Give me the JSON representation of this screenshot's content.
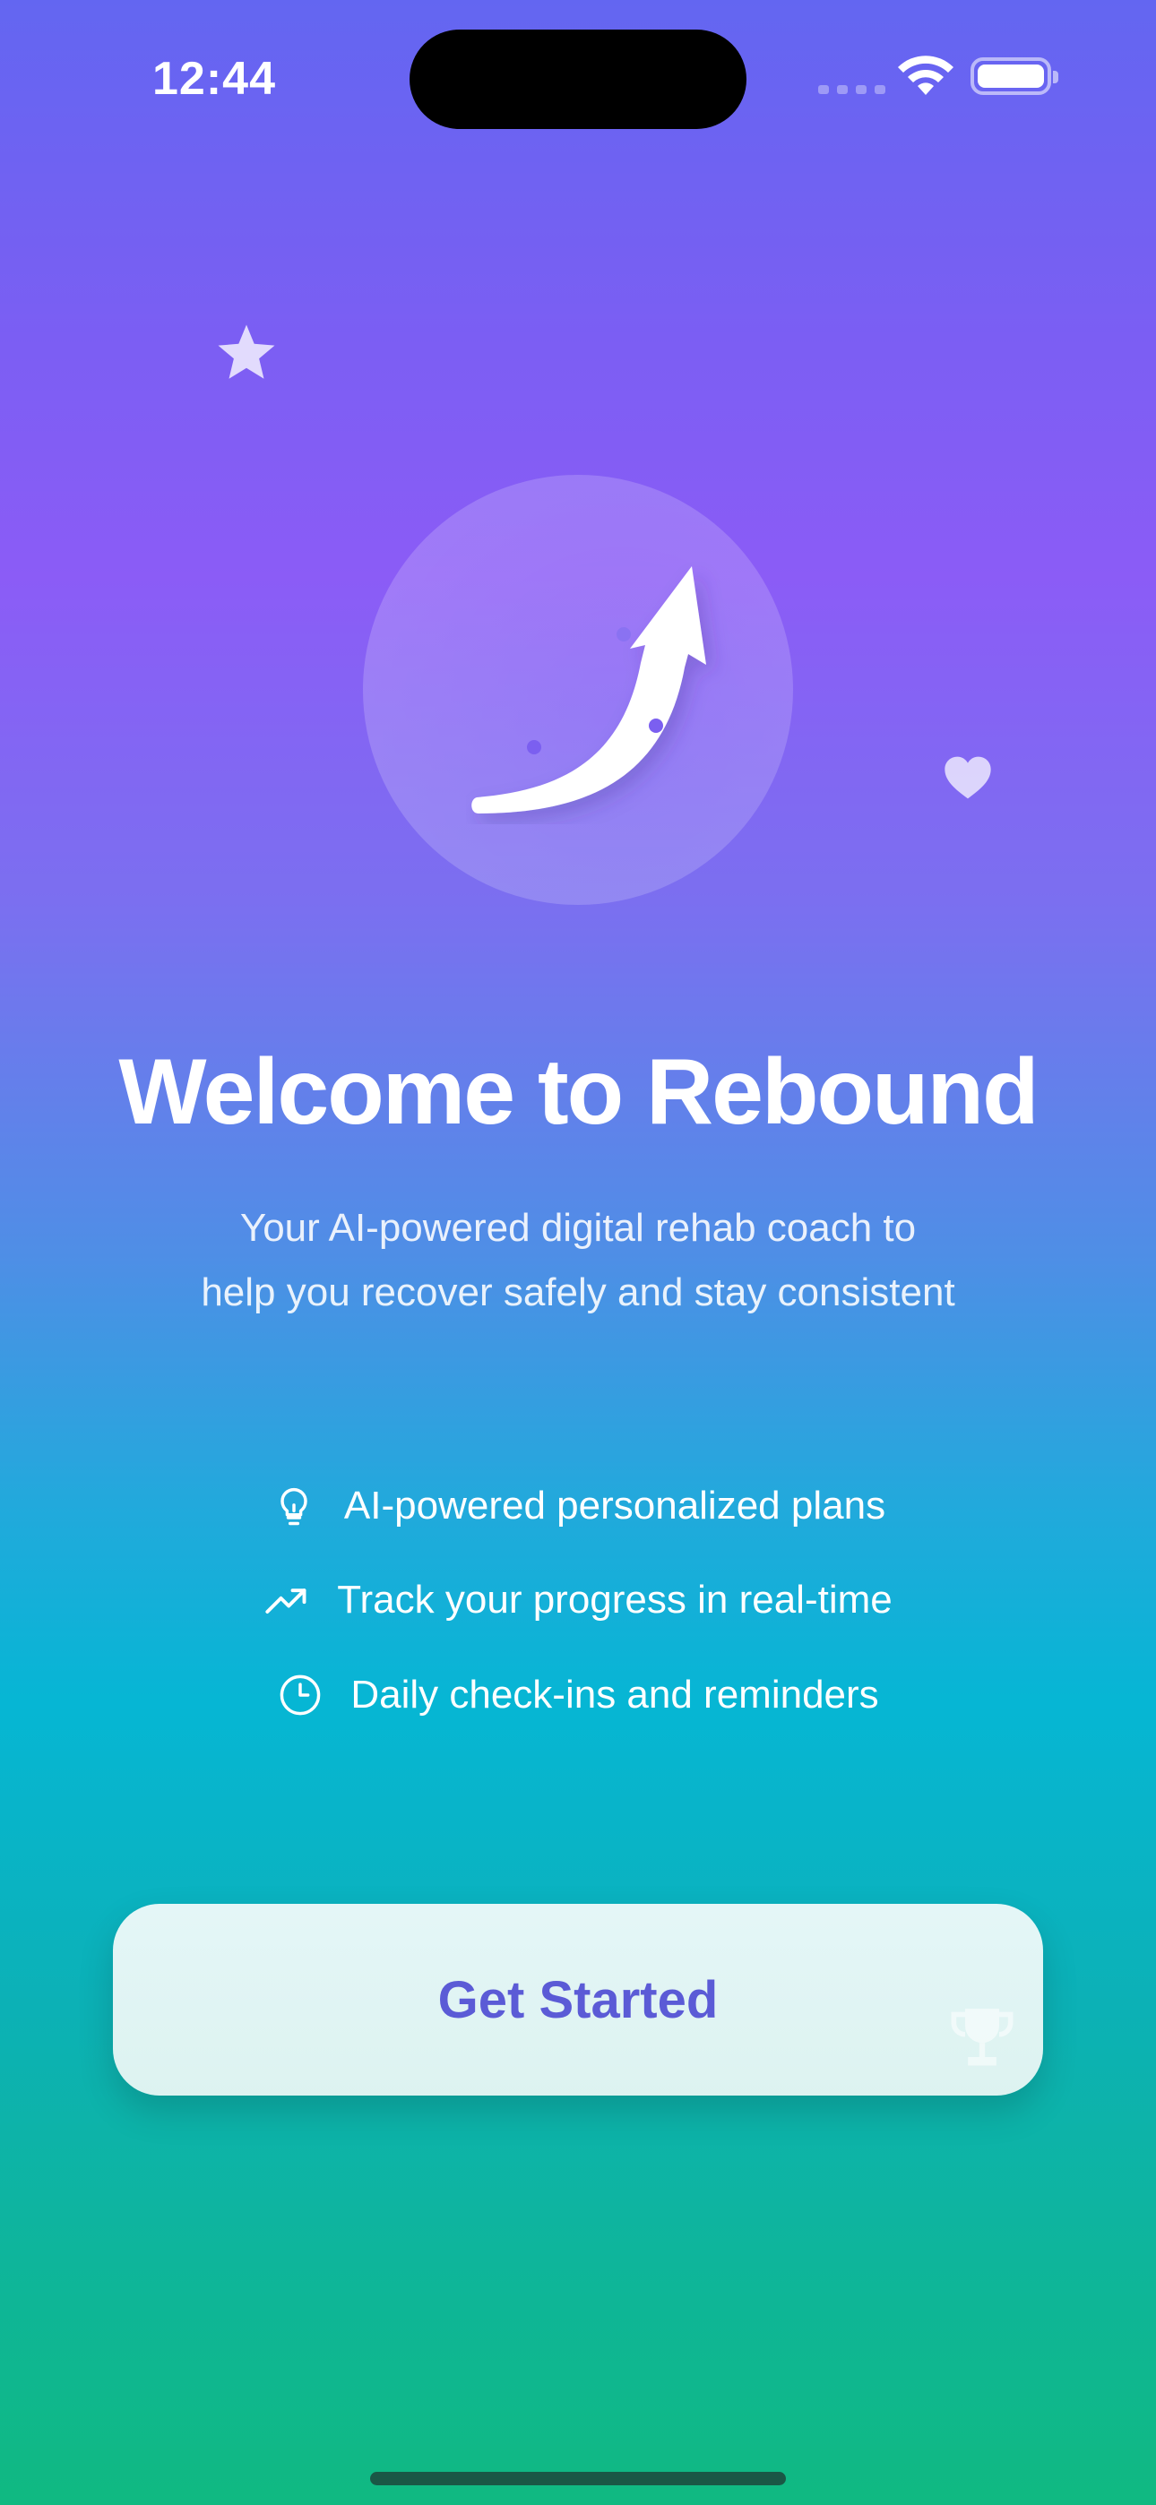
{
  "status_bar": {
    "time": "12:44",
    "icons": [
      "cellular-signal-icon",
      "wifi-icon",
      "battery-icon"
    ]
  },
  "decorations": [
    "star-icon",
    "heart-icon",
    "trophy-icon"
  ],
  "hero": {
    "icon": "trending-up-arrow-icon"
  },
  "welcome": {
    "title": "Welcome to Rebound",
    "subtitle_line1": "Your AI-powered digital rehab coach to",
    "subtitle_line2": "help you recover safely and stay consistent"
  },
  "features": [
    {
      "icon": "lightbulb-icon",
      "label": "AI-powered personalized plans"
    },
    {
      "icon": "trending-up-icon",
      "label": "Track your progress in real-time"
    },
    {
      "icon": "clock-icon",
      "label": "Daily check-ins and reminders"
    }
  ],
  "cta": {
    "label": "Get Started"
  },
  "colors": {
    "gradient_top": "#6366f1",
    "gradient_mid": "#8b5cf6",
    "gradient_cyan": "#06b6d4",
    "gradient_bottom": "#10b981",
    "button_text": "#5b5bd6"
  }
}
